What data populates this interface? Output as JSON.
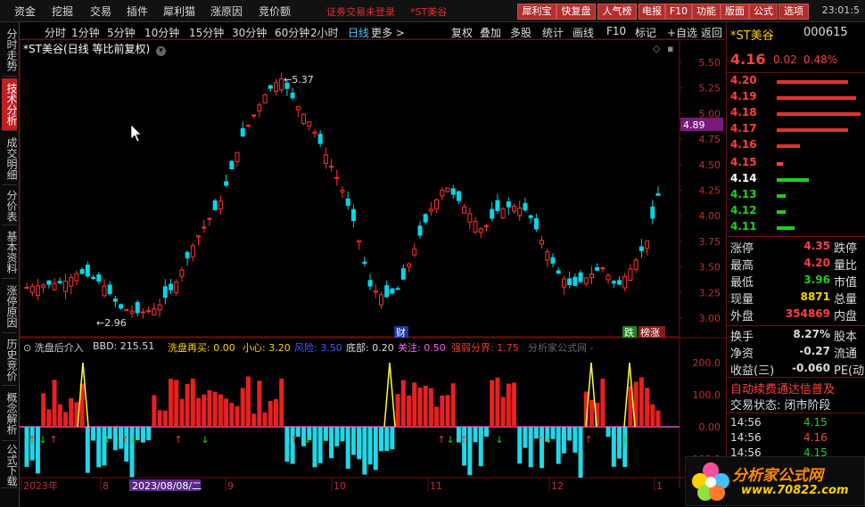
{
  "menu": {
    "items": [
      "资金",
      "挖掘",
      "交易",
      "插件",
      "犀利猫",
      "涨原因",
      "竞价额"
    ],
    "notice": "证券交易未登录",
    "notice_stock": "*ST美谷",
    "buttons": [
      "犀利宝",
      "快复盘",
      "人气榜",
      "电报",
      "F10",
      "功能",
      "版面",
      "公式",
      "选项"
    ],
    "clock": "23:01:5"
  },
  "sidebar": {
    "tabs": [
      "分时走势",
      "技术分析",
      "成交明细",
      "分价表",
      "基本资料",
      "涨停原因",
      "历史竞价",
      "概念解析",
      "公式下载"
    ],
    "active_index": 1
  },
  "toolbar": {
    "periods": [
      "分时",
      "1分钟",
      "5分钟",
      "10分钟",
      "15分钟",
      "30分钟",
      "60分钟",
      "2小时",
      "日线",
      "更多 >"
    ],
    "selected": "日线",
    "actions": [
      "复权",
      "叠加",
      "多股",
      "统计",
      "画线",
      "F10",
      "标记",
      "+自选",
      "返回"
    ]
  },
  "chart_title": "*ST美谷(日线 等比前复权)",
  "main_chart": {
    "y_ticks": [
      "5.50",
      "5.25",
      "5.00",
      "4.75",
      "4.50",
      "4.25",
      "4.00",
      "3.75",
      "3.50",
      "3.25",
      "3.00"
    ],
    "current_price_tag": "4.89",
    "high_label": "5.37",
    "low_label": "2.96",
    "marker_cai": "财",
    "marker_die": "跌",
    "marker_rong": "榜涨",
    "colors": {
      "up": "#ff3030",
      "down": "#00d8e8"
    }
  },
  "indicator": {
    "name": "洗盘后介入",
    "bbd_label": "BBD: 215.51",
    "wash": "洗盘再买: 0.00",
    "careful": "小心: 3.20",
    "risk": "风险: 3.50",
    "bottom": "底部: 0.20",
    "watch": "关注: 0.50",
    "boundary": "强弱分界: 1.75",
    "source": "分析家公式网 -",
    "y_ticks": [
      "200.0",
      "100.0",
      "0.00",
      "-100.0"
    ]
  },
  "time_axis": {
    "labels": [
      "2023年",
      "8",
      "2023/08/08/二",
      "9",
      "10",
      "11",
      "12",
      "1"
    ]
  },
  "quote": {
    "name": "*ST美谷",
    "code": "000615",
    "price": "4.16",
    "change": "0.02",
    "pct": "0.48%",
    "asks": [
      {
        "price": "4.20",
        "bar": 0.85
      },
      {
        "price": "4.19",
        "bar": 0.95
      },
      {
        "price": "4.18",
        "bar": 1.0
      },
      {
        "price": "4.17",
        "bar": 0.85
      },
      {
        "price": "4.16",
        "bar": 0.28
      }
    ],
    "bids": [
      {
        "price": "4.15",
        "bar": 0.1,
        "color": "#ff4040"
      },
      {
        "price": "4.14",
        "bar": 0.55,
        "color": "#ffffff"
      },
      {
        "price": "4.13",
        "bar": 0.15,
        "color": "#20d020"
      },
      {
        "price": "4.12",
        "bar": 0.15,
        "color": "#20d020"
      },
      {
        "price": "4.11",
        "bar": 0.3,
        "color": "#20d020"
      }
    ],
    "stats": [
      {
        "label": "涨停",
        "value": "4.35",
        "tail": "跌停",
        "color": "#ff4040"
      },
      {
        "label": "最高",
        "value": "4.20",
        "tail": "量比",
        "color": "#ff4040"
      },
      {
        "label": "最低",
        "value": "3.96",
        "tail": "市值",
        "color": "#20d020"
      },
      {
        "label": "现量",
        "value": "8871",
        "tail": "总量",
        "color": "#ffd200"
      },
      {
        "label": "外盘",
        "value": "354869",
        "tail": "内盘",
        "color": "#ff4040"
      }
    ],
    "stats2": [
      {
        "label": "换手",
        "value": "8.27%",
        "tail": "股本",
        "color": "#ddd"
      },
      {
        "label": "净资",
        "value": "-0.27",
        "tail": "流通",
        "color": "#ddd"
      },
      {
        "label": "收益(三)",
        "value": "-0.060",
        "tail": "PE(动",
        "color": "#ddd"
      }
    ],
    "auto_renew": "自动续费通达信普及",
    "trade_status": "交易状态: 闭市阶段",
    "ticks": [
      {
        "time": "14:56",
        "price": "4.15",
        "color": "#20d020"
      },
      {
        "time": "14:56",
        "price": "4.16",
        "color": "#ff4040"
      },
      {
        "time": "14:56",
        "price": "4.15",
        "color": "#20d020"
      }
    ]
  },
  "logo": {
    "text": "分析家公式网",
    "url": "www.70822.com"
  }
}
